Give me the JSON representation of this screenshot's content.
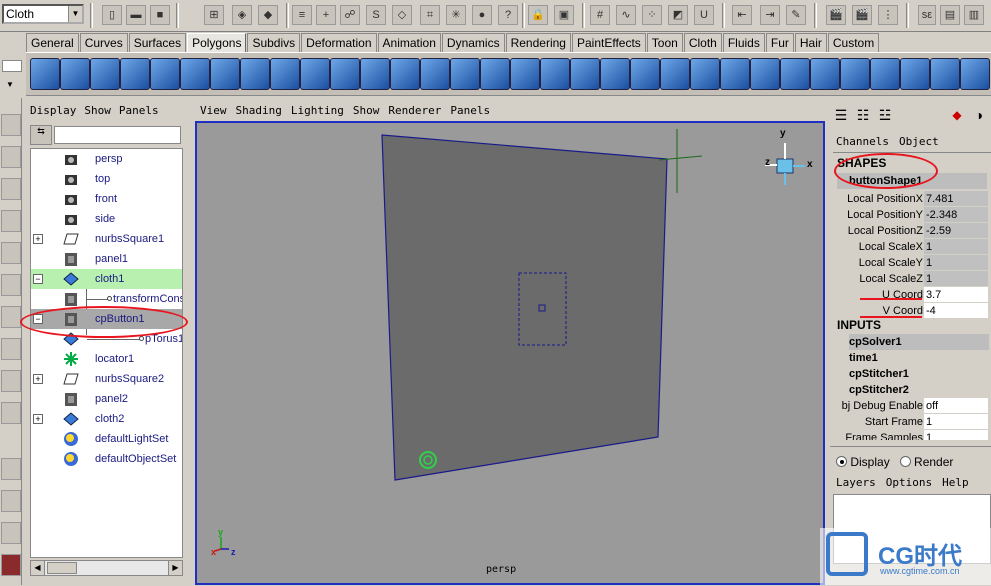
{
  "statusline": {
    "menuset": "Cloth"
  },
  "shelf_tabs": [
    "General",
    "Curves",
    "Surfaces",
    "Polygons",
    "Subdivs",
    "Deformation",
    "Animation",
    "Dynamics",
    "Rendering",
    "PaintEffects",
    "Toon",
    "Cloth",
    "Fluids",
    "Fur",
    "Hair",
    "Custom"
  ],
  "active_shelf": "Polygons",
  "outliner": {
    "menu": [
      "Display",
      "Show",
      "Panels"
    ],
    "items": [
      {
        "label": "persp",
        "icon": "camera-icon"
      },
      {
        "label": "top",
        "icon": "camera-icon"
      },
      {
        "label": "front",
        "icon": "camera-icon"
      },
      {
        "label": "side",
        "icon": "camera-icon"
      },
      {
        "label": "nurbsSquare1",
        "icon": "nurbs-square-icon",
        "expand": "+"
      },
      {
        "label": "panel1",
        "icon": "cloth-panel-icon"
      },
      {
        "label": "cloth1",
        "icon": "cloth-mesh-icon",
        "expand": "−"
      },
      {
        "label": "transformCons",
        "icon": "cloth-panel-icon"
      },
      {
        "label": "cpButton1",
        "icon": "cloth-panel-icon",
        "expand": "−"
      },
      {
        "label": "pTorus1",
        "icon": "cloth-mesh-icon"
      },
      {
        "label": "locator1",
        "icon": "locator-icon"
      },
      {
        "label": "nurbsSquare2",
        "icon": "nurbs-square-icon",
        "expand": "+"
      },
      {
        "label": "panel2",
        "icon": "cloth-panel-icon"
      },
      {
        "label": "cloth2",
        "icon": "cloth-mesh-icon",
        "expand": "+"
      },
      {
        "label": "defaultLightSet",
        "icon": "set-icon"
      },
      {
        "label": "defaultObjectSet",
        "icon": "set-icon"
      }
    ]
  },
  "viewport": {
    "menu": [
      "View",
      "Shading",
      "Lighting",
      "Show",
      "Renderer",
      "Panels"
    ],
    "camera_label": "persp",
    "view_cube_axes": [
      "y",
      "z",
      "x"
    ],
    "origin_axes": [
      "y",
      "x",
      "z"
    ]
  },
  "channelbox": {
    "menu": [
      "Channels",
      "Object"
    ],
    "shapes_header": "SHAPES",
    "shape_name": "buttonShape1",
    "attrs": [
      {
        "k": "Local PositionX",
        "v": "7.481"
      },
      {
        "k": "Local PositionY",
        "v": "-2.348"
      },
      {
        "k": "Local PositionZ",
        "v": "-2.59"
      },
      {
        "k": "Local ScaleX",
        "v": "1"
      },
      {
        "k": "Local ScaleY",
        "v": "1"
      },
      {
        "k": "Local ScaleZ",
        "v": "1"
      },
      {
        "k": "U Coord",
        "v": "3.7"
      },
      {
        "k": "V Coord",
        "v": "-4"
      }
    ],
    "inputs_header": "INPUTS",
    "inputs": [
      "cpSolver1",
      "time1",
      "cpStitcher1",
      "cpStitcher2"
    ],
    "input_attrs": [
      {
        "k": "bj Debug Enable",
        "v": "off"
      },
      {
        "k": "Start Frame",
        "v": "1"
      },
      {
        "k": "Frame Samples",
        "v": "1"
      }
    ]
  },
  "layers": {
    "display_label": "Display",
    "render_label": "Render",
    "menu": [
      "Layers",
      "Options",
      "Help"
    ]
  },
  "watermark": {
    "brand": "CG时代",
    "url": "www.cgtime.com.cn"
  },
  "annotation_color": "#e8141e"
}
